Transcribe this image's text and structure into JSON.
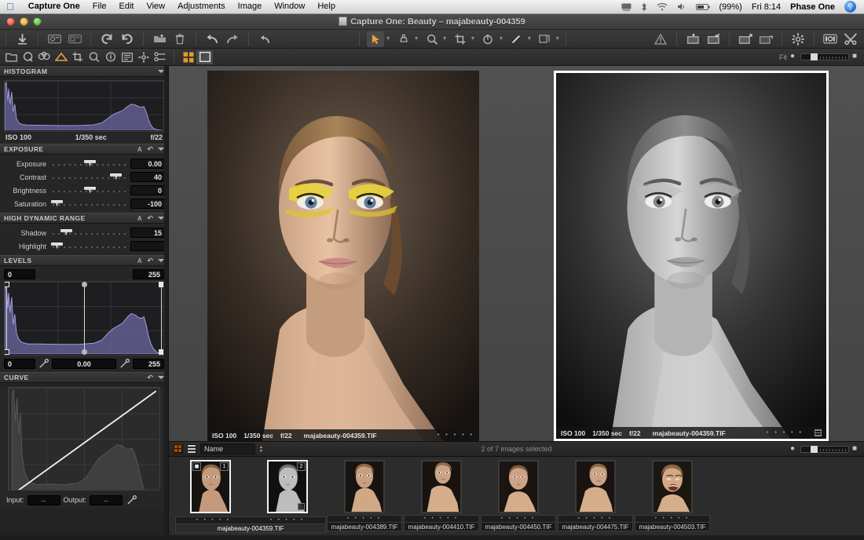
{
  "menubar": {
    "apple_icon": "apple-logo",
    "app_name": "Capture One",
    "items": [
      "File",
      "Edit",
      "View",
      "Adjustments",
      "Image",
      "Window",
      "Help"
    ],
    "status_icons": [
      "display-icon",
      "bluetooth-icon",
      "wifi-icon",
      "volume-icon",
      "battery-icon"
    ],
    "battery": "(99%)",
    "clock": "Fri 8:14",
    "user": "Phase One",
    "spotlight_icon": "search-icon"
  },
  "window": {
    "title": "Capture One: Beauty – majabeauty-004359",
    "traffic_lights": [
      "close-button",
      "minimize-button",
      "zoom-button"
    ]
  },
  "toolbar": {
    "left_group": [
      {
        "name": "import-images-button",
        "glyph": "download-arrow-icon"
      }
    ],
    "capture_group": [
      {
        "name": "capture-button",
        "glyph": "camera-capture-icon"
      },
      {
        "name": "capture-next-button",
        "glyph": "camera-next-icon"
      }
    ],
    "rotate_group": [
      {
        "name": "rotate-left-button",
        "glyph": "rotate-ccw-icon"
      },
      {
        "name": "rotate-right-button",
        "glyph": "rotate-cw-icon"
      }
    ],
    "file_group": [
      {
        "name": "open-folder-button",
        "glyph": "folder-open-icon"
      },
      {
        "name": "delete-button",
        "glyph": "trash-icon"
      }
    ],
    "history_group": [
      {
        "name": "undo-button",
        "glyph": "undo-arrow-icon"
      },
      {
        "name": "redo-button",
        "glyph": "redo-arrow-icon"
      }
    ],
    "reset_group": [
      {
        "name": "reset-button",
        "glyph": "reset-arrow-icon"
      }
    ],
    "center_group": [
      {
        "name": "select-tool-button",
        "glyph": "cursor-arrow-icon"
      },
      {
        "name": "color-picker-tool-button",
        "glyph": "picker-icon"
      },
      {
        "name": "zoom-tool-button",
        "glyph": "magnifier-icon"
      },
      {
        "name": "crop-tool-button",
        "glyph": "crop-icon"
      },
      {
        "name": "rotate-tool-button",
        "glyph": "rotate-tool-icon"
      },
      {
        "name": "draw-tool-button",
        "glyph": "pen-icon"
      },
      {
        "name": "copy-adjustments-button",
        "glyph": "copy-adjust-icon"
      }
    ],
    "right_group": [
      {
        "name": "warning-button",
        "glyph": "warning-triangle-icon"
      },
      {
        "name": "add-to-album-button",
        "glyph": "album-add-icon"
      },
      {
        "name": "check-album-button",
        "glyph": "album-check-icon"
      },
      {
        "name": "export-images-button",
        "glyph": "export-icon"
      },
      {
        "name": "process-button",
        "glyph": "process-icon"
      },
      {
        "name": "preferences-button",
        "glyph": "gear-icon"
      },
      {
        "name": "exposure-eval-button",
        "glyph": "exposure-meter-icon"
      },
      {
        "name": "customize-toolbar-button",
        "glyph": "tools-icon"
      }
    ]
  },
  "subtoolbar": {
    "tools": [
      {
        "name": "library-tool",
        "glyph": "folder-icon",
        "active": false
      },
      {
        "name": "quick-tool",
        "glyph": "q-circle-icon",
        "active": false
      },
      {
        "name": "color-tool",
        "glyph": "color-circles-icon",
        "active": false
      },
      {
        "name": "exposure-tool",
        "glyph": "exposure-triangle-icon",
        "active": true
      },
      {
        "name": "lens-tool",
        "glyph": "crop-lens-icon",
        "active": false
      },
      {
        "name": "focus-tool",
        "glyph": "focus-magnifier-icon",
        "active": false
      },
      {
        "name": "metadata-tool",
        "glyph": "info-circle-icon",
        "active": false
      },
      {
        "name": "library-list-tool",
        "glyph": "list-icon",
        "active": false
      },
      {
        "name": "adjustments-tool",
        "glyph": "gear-icon",
        "active": false
      },
      {
        "name": "batch-tool",
        "glyph": "batch-icon",
        "active": false
      }
    ],
    "view_modes": [
      {
        "name": "grid-view-button",
        "glyph": "grid-icon",
        "active": true
      },
      {
        "name": "single-view-button",
        "glyph": "single-frame-icon",
        "active": false
      }
    ],
    "zoom_label": "Fit"
  },
  "panels": {
    "histogram": {
      "title": "HISTOGRAM",
      "iso": "ISO 100",
      "shutter": "1/350 sec",
      "aperture": "f/22"
    },
    "exposure": {
      "title": "EXPOSURE",
      "auto_label": "A",
      "sliders": [
        {
          "label": "Exposure",
          "value": "0.00",
          "pos": 50
        },
        {
          "label": "Contrast",
          "value": "40",
          "pos": 84
        },
        {
          "label": "Brightness",
          "value": "0",
          "pos": 50
        },
        {
          "label": "Saturation",
          "value": "-100",
          "pos": 2
        }
      ]
    },
    "hdr": {
      "title": "HIGH DYNAMIC RANGE",
      "auto_label": "A",
      "sliders": [
        {
          "label": "Shadow",
          "value": "15",
          "pos": 12
        },
        {
          "label": "Highlight",
          "value": "",
          "pos": 1
        }
      ]
    },
    "levels": {
      "title": "LEVELS",
      "auto_label": "A",
      "top_left": "0",
      "top_right": "255",
      "bottom_left": "0",
      "bottom_mid": "0.00",
      "bottom_right": "255",
      "pickers": [
        "black-point-picker",
        "white-point-picker"
      ]
    },
    "curve": {
      "title": "CURVE",
      "input_label": "Input:",
      "output_label": "Output:",
      "input_value": "--",
      "output_value": "--",
      "picker": "curve-picker"
    }
  },
  "viewer": {
    "images": [
      {
        "name": "primary-variant",
        "iso": "ISO 100",
        "shutter": "1/350 sec",
        "aperture": "f/22",
        "filename": "majabeauty-004359.TIF",
        "stars": "• • • • •",
        "mono": false
      },
      {
        "name": "secondary-variant",
        "iso": "ISO 100",
        "shutter": "1/350 sec",
        "aperture": "f/22",
        "filename": "majabeauty-004359.TIF",
        "stars": "• • • • •",
        "mono": true
      }
    ]
  },
  "browser": {
    "sort_field": "Name",
    "status": "2 of 7 images selected",
    "view_toggles": [
      "thumbnail-grid-toggle",
      "list-view-toggle"
    ]
  },
  "filmstrip": {
    "thumbnails": [
      {
        "filename": "majabeauty-004359.TIF",
        "badge": "1",
        "selected": true,
        "mono": false,
        "stars": "• • • • •",
        "has_camera_badge": true,
        "wide": true
      },
      {
        "filename": "",
        "badge": "2",
        "selected": true,
        "mono": true,
        "stars": "• • • • •",
        "has_camera_badge": false,
        "wide": false
      },
      {
        "filename": "majabeauty-004389.TIF",
        "badge": "",
        "selected": false,
        "mono": false,
        "stars": "• • • • •",
        "has_camera_badge": false,
        "wide": false
      },
      {
        "filename": "majabeauty-004410.TIF",
        "badge": "",
        "selected": false,
        "mono": false,
        "stars": "• • • • •",
        "has_camera_badge": false,
        "wide": false
      },
      {
        "filename": "majabeauty-004450.TIF",
        "badge": "",
        "selected": false,
        "mono": false,
        "stars": "• • • • •",
        "has_camera_badge": false,
        "wide": false
      },
      {
        "filename": "majabeauty-004475.TIF",
        "badge": "",
        "selected": false,
        "mono": false,
        "stars": "• • • • •",
        "has_camera_badge": false,
        "wide": false
      },
      {
        "filename": "majabeauty-004503.TIF",
        "badge": "",
        "selected": false,
        "mono": false,
        "stars": "• • • • •",
        "has_camera_badge": false,
        "wide": false
      }
    ]
  },
  "colors": {
    "accent": "#e8a33d",
    "panel_bg": "#262626",
    "histogram_curve": "#8f8cc8"
  }
}
